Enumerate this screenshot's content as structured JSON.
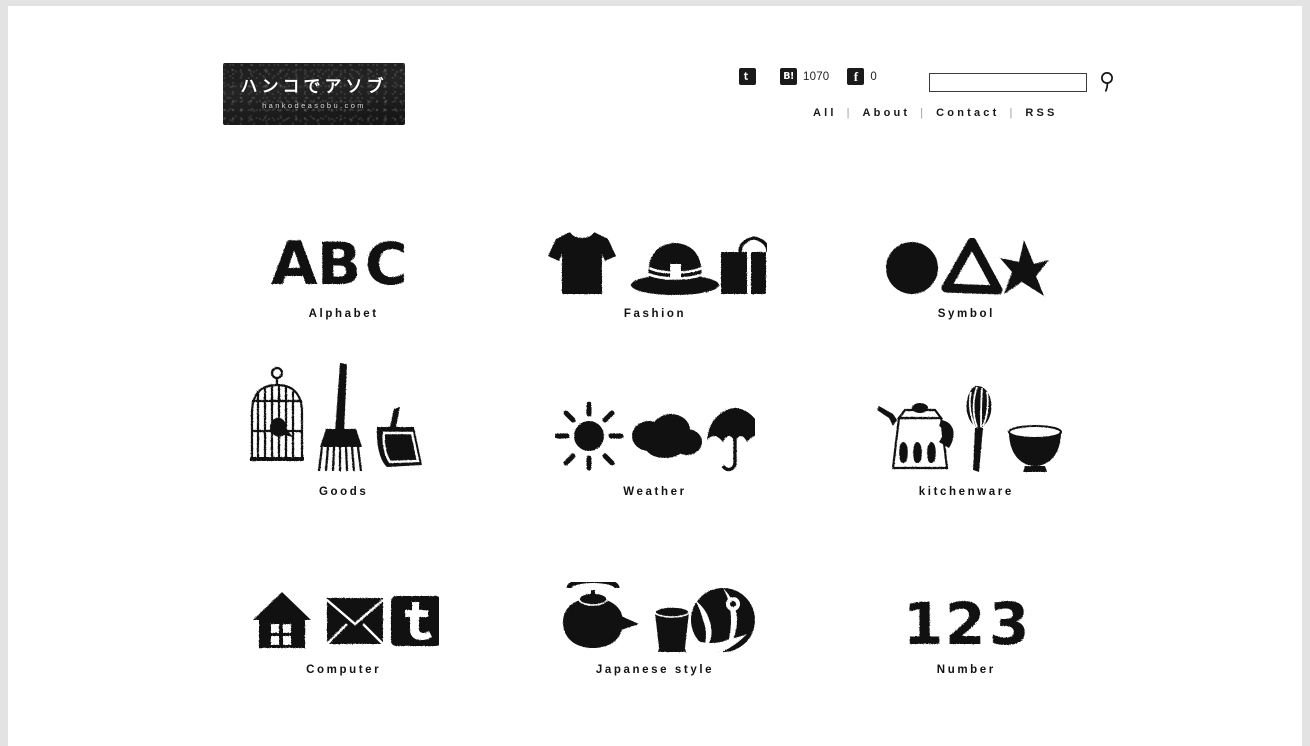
{
  "site": {
    "logo_jp": "ハンコでアソブ",
    "logo_domain": "hankodeasobu.com"
  },
  "header": {
    "social": [
      {
        "icon": "twitter-icon",
        "glyph": "t",
        "count": ""
      },
      {
        "icon": "hatena-bookmark-icon",
        "glyph": "B!",
        "count": "1070"
      },
      {
        "icon": "facebook-icon",
        "glyph": "f",
        "count": "0"
      }
    ],
    "search": {
      "value": "",
      "placeholder": "",
      "button_label": "search-icon"
    },
    "nav": [
      {
        "label": "All"
      },
      {
        "label": "About"
      },
      {
        "label": "Contact"
      },
      {
        "label": "RSS"
      }
    ],
    "nav_separator": "|"
  },
  "categories": [
    {
      "label": "Alphabet",
      "art": "abc-letters"
    },
    {
      "label": "Fashion",
      "art": "tshirt-hat-suitcase"
    },
    {
      "label": "Symbol",
      "art": "circle-triangle-star"
    },
    {
      "label": "Goods",
      "art": "birdcage-broom-dustpan"
    },
    {
      "label": "Weather",
      "art": "sun-cloud-umbrella"
    },
    {
      "label": "kitchenware",
      "art": "kettle-whisk-bowl"
    },
    {
      "label": "Computer",
      "art": "house-mail-twitter"
    },
    {
      "label": "Japanese style",
      "art": "teapot-cup-ball"
    },
    {
      "label": "Number",
      "art": "123-digits"
    }
  ],
  "colors": {
    "ink": "#141414",
    "page": "#ffffff",
    "frame": "#e3e3e3"
  }
}
